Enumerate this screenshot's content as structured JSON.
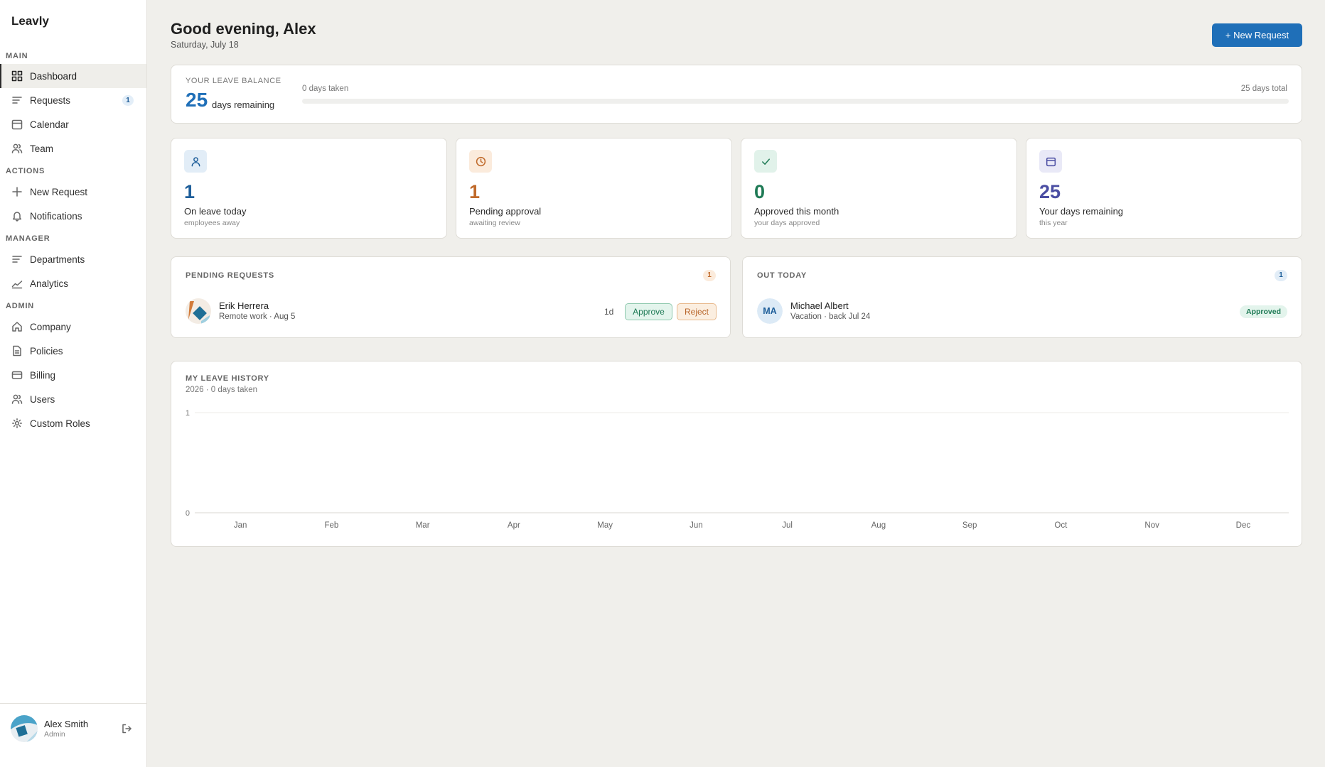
{
  "sidebar": {
    "brand": "Leavly",
    "sections": {
      "main": "MAIN",
      "actions": "ACTIONS",
      "manager": "MANAGER",
      "admin": "ADMIN"
    },
    "items": {
      "dashboard": "Dashboard",
      "requests": "Requests",
      "requests_badge": "1",
      "calendar": "Calendar",
      "team": "Team",
      "new_request": "New Request",
      "notifications": "Notifications",
      "departments": "Departments",
      "analytics": "Analytics",
      "company": "Company",
      "policies": "Policies",
      "billing": "Billing",
      "users": "Users",
      "custom_roles": "Custom Roles"
    },
    "user": {
      "name": "Alex Smith",
      "role": "Admin"
    }
  },
  "header": {
    "greeting": "Good evening, Alex",
    "date": "Saturday, July 18",
    "new_request_label": "+ New Request"
  },
  "balance": {
    "label": "YOUR LEAVE BALANCE",
    "remaining": "25",
    "remaining_unit": "days remaining",
    "taken_label": "0 days taken",
    "total_label": "25 days total",
    "taken_fraction": 0
  },
  "stats": [
    {
      "icon": "person-icon",
      "value": "1",
      "title": "On leave today",
      "sub": "employees away",
      "color": "#1f5f9a",
      "tint": "#e2edf7"
    },
    {
      "icon": "clock-icon",
      "value": "1",
      "title": "Pending approval",
      "sub": "awaiting review",
      "color": "#c06a2b",
      "tint": "#fbebdc"
    },
    {
      "icon": "check-icon",
      "value": "0",
      "title": "Approved this month",
      "sub": "your days approved",
      "color": "#1e7a55",
      "tint": "#e1f2ea"
    },
    {
      "icon": "calendar-icon",
      "value": "25",
      "title": "Your days remaining",
      "sub": "this year",
      "color": "#4b4ea3",
      "tint": "#e9e9f7"
    }
  ],
  "pending": {
    "title": "PENDING REQUESTS",
    "count": "1",
    "item": {
      "name": "Erik Herrera",
      "detail": "Remote work · Aug 5",
      "duration": "1d",
      "approve_label": "Approve",
      "reject_label": "Reject"
    }
  },
  "out_today": {
    "title": "OUT TODAY",
    "count": "1",
    "item": {
      "initials": "MA",
      "name": "Michael Albert",
      "detail": "Vacation · back Jul 24",
      "status": "Approved"
    }
  },
  "history": {
    "title": "MY LEAVE HISTORY",
    "subtitle": "2026 · 0 days taken"
  },
  "chart_data": {
    "type": "bar",
    "title": "MY LEAVE HISTORY",
    "subtitle": "2026 · 0 days taken",
    "categories": [
      "Jan",
      "Feb",
      "Mar",
      "Apr",
      "May",
      "Jun",
      "Jul",
      "Aug",
      "Sep",
      "Oct",
      "Nov",
      "Dec"
    ],
    "values": [
      0,
      0,
      0,
      0,
      0,
      0,
      0,
      0,
      0,
      0,
      0,
      0
    ],
    "ylim": [
      0,
      1
    ],
    "yticks": [
      "0",
      "1"
    ],
    "xlabel": "",
    "ylabel": "",
    "grid": true,
    "color": "#1f6fb8"
  }
}
